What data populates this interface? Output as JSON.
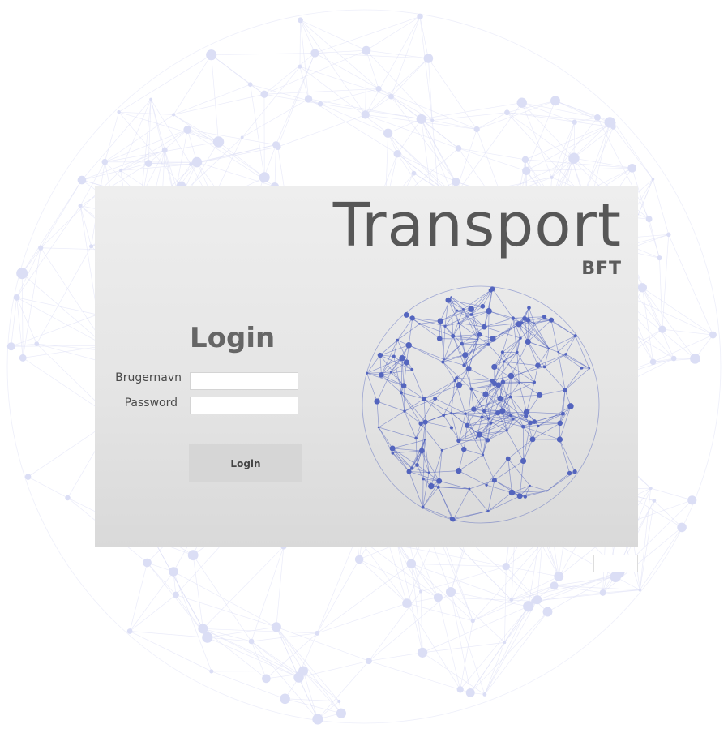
{
  "app": {
    "title": "Transport",
    "subtitle": "BFT"
  },
  "login_form": {
    "heading": "Login",
    "username_label": "Brugernavn",
    "username_value": "",
    "password_label": "Password",
    "password_value": "",
    "submit_label": "Login"
  },
  "colors": {
    "background_network": "#c9cdf0",
    "globe_network": "#3b4fb8",
    "panel_gradient_top": "#eeeeee",
    "panel_gradient_bottom": "#d9d9d9",
    "title_text": "#575757",
    "button_bg": "#d6d6d6"
  }
}
